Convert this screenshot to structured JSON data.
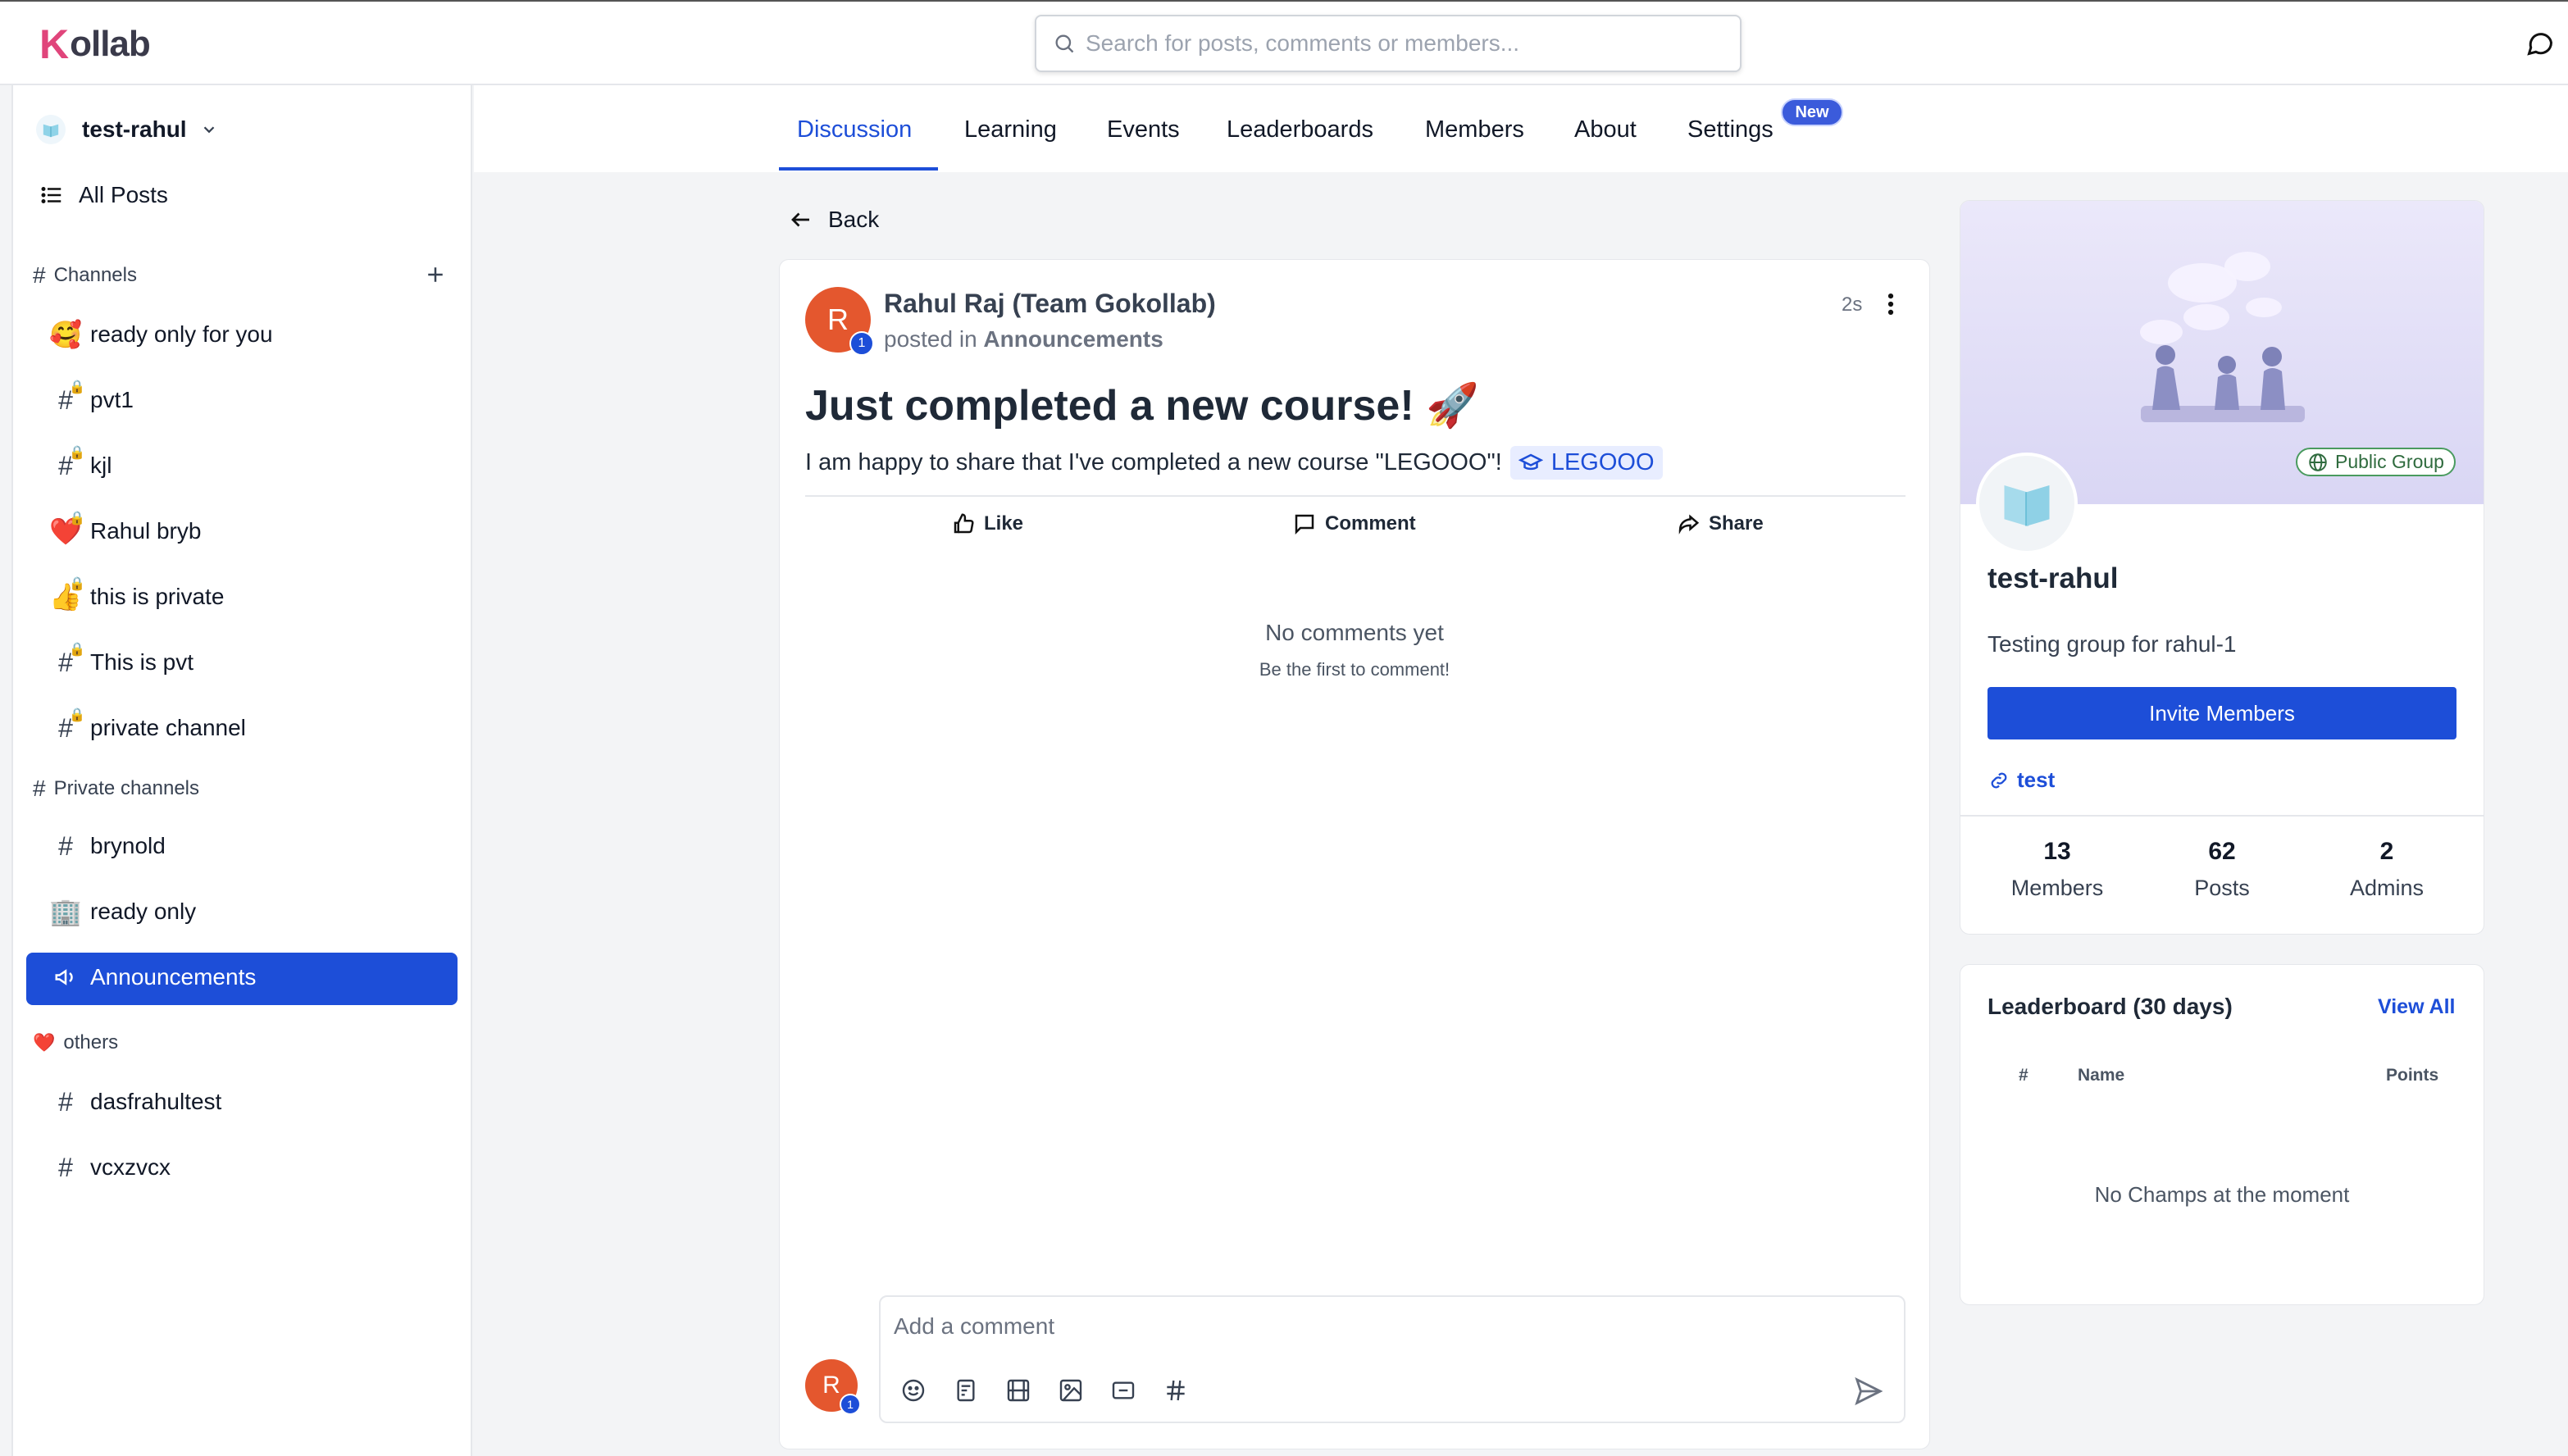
{
  "app": {
    "logo_k": "K",
    "logo_rest": "ollab"
  },
  "search": {
    "placeholder": "Search for posts, comments or members..."
  },
  "sidebar": {
    "group_name": "test-rahul",
    "all_posts": "All Posts",
    "channels_header": "Channels",
    "channels": [
      {
        "label": "ready only for you",
        "icon": "🥰"
      },
      {
        "label": "pvt1",
        "icon": "#"
      },
      {
        "label": "kjl",
        "icon": "#"
      },
      {
        "label": "Rahul bryb",
        "icon": "❤️"
      },
      {
        "label": "this is private",
        "icon": "👍"
      },
      {
        "label": "This is pvt",
        "icon": "#"
      },
      {
        "label": "private channel",
        "icon": "#"
      }
    ],
    "private_header": "Private channels",
    "private_channels": [
      {
        "label": "brynold",
        "icon": "#"
      },
      {
        "label": "ready only",
        "icon": "🏢"
      },
      {
        "label": "Announcements",
        "icon": "📢"
      }
    ],
    "others_header": "others",
    "others_icon": "❤️",
    "others": [
      {
        "label": "dasfrahultest",
        "icon": "#"
      },
      {
        "label": "vcxzvcx",
        "icon": "#"
      }
    ]
  },
  "tabs": [
    "Discussion",
    "Learning",
    "Events",
    "Leaderboards",
    "Members",
    "About",
    "Settings"
  ],
  "new_badge": "New",
  "back_label": "Back",
  "post": {
    "author": "Rahul Raj (Team Gokollab)",
    "avatar_letter": "R",
    "level": "1",
    "posted_in_prefix": "posted in",
    "channel": "Announcements",
    "time": "2s",
    "title": "Just completed a new course! 🚀",
    "body": "I am happy to share that I've completed a new course \"LEGOOO\"!",
    "course_chip": "LEGOOO",
    "actions": {
      "like": "Like",
      "comment": "Comment",
      "share": "Share"
    },
    "no_comments": "No comments yet",
    "be_first": "Be the first to comment!"
  },
  "comment_box": {
    "placeholder": "Add a comment"
  },
  "group": {
    "badge": "Public Group",
    "name": "test-rahul",
    "description": "Testing group for rahul-1",
    "invite_label": "Invite Members",
    "link_label": "test",
    "stats": [
      {
        "value": "13",
        "label": "Members"
      },
      {
        "value": "62",
        "label": "Posts"
      },
      {
        "value": "2",
        "label": "Admins"
      }
    ]
  },
  "leaderboard": {
    "title": "Leaderboard (30 days)",
    "view_all": "View All",
    "columns": [
      "#",
      "Name",
      "Points"
    ],
    "empty": "No Champs at the moment"
  },
  "colors": {
    "accent": "#1d4ed8",
    "avatar": "#e4572e",
    "logo_k": "#e0457b"
  }
}
